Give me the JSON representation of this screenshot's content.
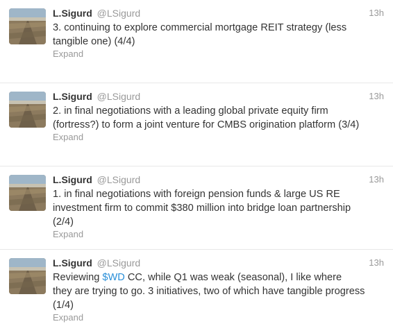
{
  "tweets": [
    {
      "fullname": "L.Sigurd",
      "username": "@LSigurd",
      "time": "13h",
      "lines": [
        "3. continuing to explore commercial mortgage REIT strategy (less",
        "tangible one) (4/4)"
      ],
      "expand_label": "Expand"
    },
    {
      "fullname": "L.Sigurd",
      "username": "@LSigurd",
      "time": "13h",
      "lines": [
        "2. in final negotiations with a leading global private equity firm",
        "(fortress?) to form a joint venture for CMBS origination platform (3/4)"
      ],
      "expand_label": "Expand"
    },
    {
      "fullname": "L.Sigurd",
      "username": "@LSigurd",
      "time": "13h",
      "lines": [
        "1. in final negotiations with foreign pension funds & large US RE",
        "investment firm to commit $380 million into bridge loan partnership",
        "(2/4)"
      ],
      "expand_label": "Expand"
    },
    {
      "fullname": "L.Sigurd",
      "username": "@LSigurd",
      "time": "13h",
      "line1_prefix": "Reviewing ",
      "cashtag": "$WD",
      "line1_suffix": " CC, while Q1 was weak (seasonal), I like where",
      "lines_rest": [
        "they are trying to go. 3 initiatives, two of which have tangible progress",
        "(1/4)"
      ],
      "expand_label": "Expand"
    }
  ],
  "colors": {
    "link": "#2a8fd8",
    "muted": "#999999",
    "text": "#333333"
  }
}
